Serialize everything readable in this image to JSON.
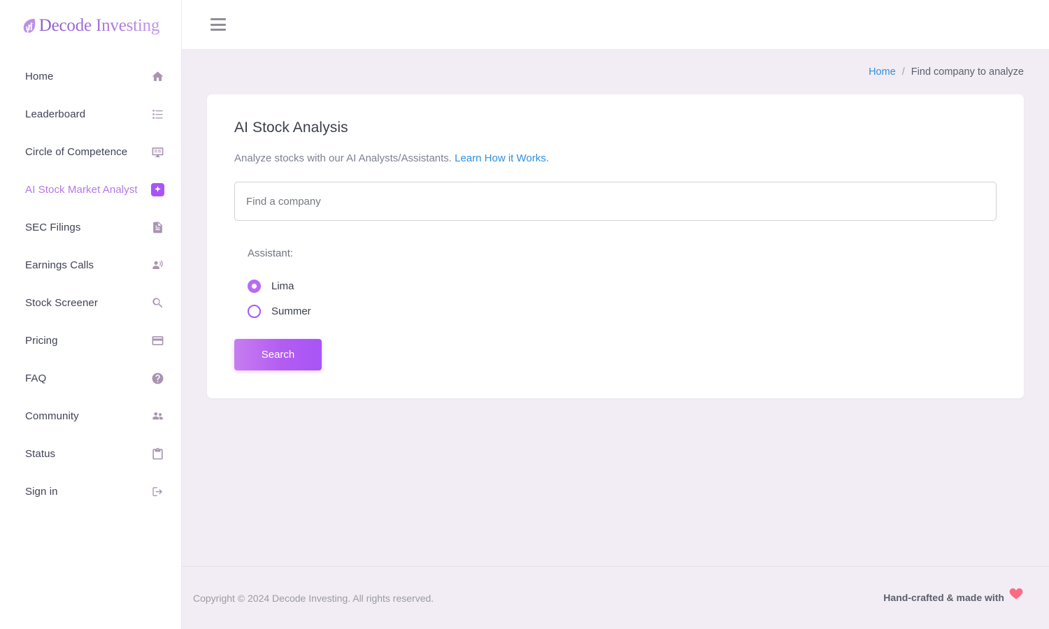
{
  "brand": {
    "name": "Decode Investing",
    "icon": "leaf-chart-logo-icon"
  },
  "topbar": {
    "menu_icon": "hamburger-menu-icon"
  },
  "sidebar": {
    "items": [
      {
        "label": "Home",
        "icon": "home-icon",
        "active": false
      },
      {
        "label": "Leaderboard",
        "icon": "list-icon",
        "active": false
      },
      {
        "label": "Circle of Competence",
        "icon": "dashboard-card-icon",
        "active": false
      },
      {
        "label": "AI Stock Market Analyst",
        "icon": "sparkle-badge-icon",
        "active": true
      },
      {
        "label": "SEC Filings",
        "icon": "document-icon",
        "active": false
      },
      {
        "label": "Earnings Calls",
        "icon": "record-voice-icon",
        "active": false
      },
      {
        "label": "Stock Screener",
        "icon": "search-icon",
        "active": false
      },
      {
        "label": "Pricing",
        "icon": "credit-card-icon",
        "active": false
      },
      {
        "label": "FAQ",
        "icon": "help-circle-icon",
        "active": false
      },
      {
        "label": "Community",
        "icon": "people-icon",
        "active": false
      },
      {
        "label": "Status",
        "icon": "clipboard-icon",
        "active": false
      },
      {
        "label": "Sign in",
        "icon": "login-icon",
        "active": false
      }
    ]
  },
  "breadcrumb": {
    "home_label": "Home",
    "separator": "/",
    "current_label": "Find company to analyze"
  },
  "card": {
    "title": "AI Stock Analysis",
    "subtitle_text": "Analyze stocks with our AI Analysts/Assistants.",
    "subtitle_link": "Learn How it Works.",
    "search_placeholder": "Find a company",
    "search_value": "",
    "assistant_label": "Assistant:",
    "assistants": [
      {
        "label": "Lima",
        "selected": true
      },
      {
        "label": "Summer",
        "selected": false
      }
    ],
    "search_button_label": "Search"
  },
  "footer": {
    "copyright": "Copyright © 2024 Decode Investing. All rights reserved.",
    "credit": "Hand-crafted & made with",
    "heart_icon": "heart-icon"
  },
  "colors": {
    "accent": "#a855f7",
    "active_nav": "#b478e8",
    "link": "#2f8fe0",
    "page_bg": "#f2edf4",
    "heart": "#fb6b84"
  }
}
